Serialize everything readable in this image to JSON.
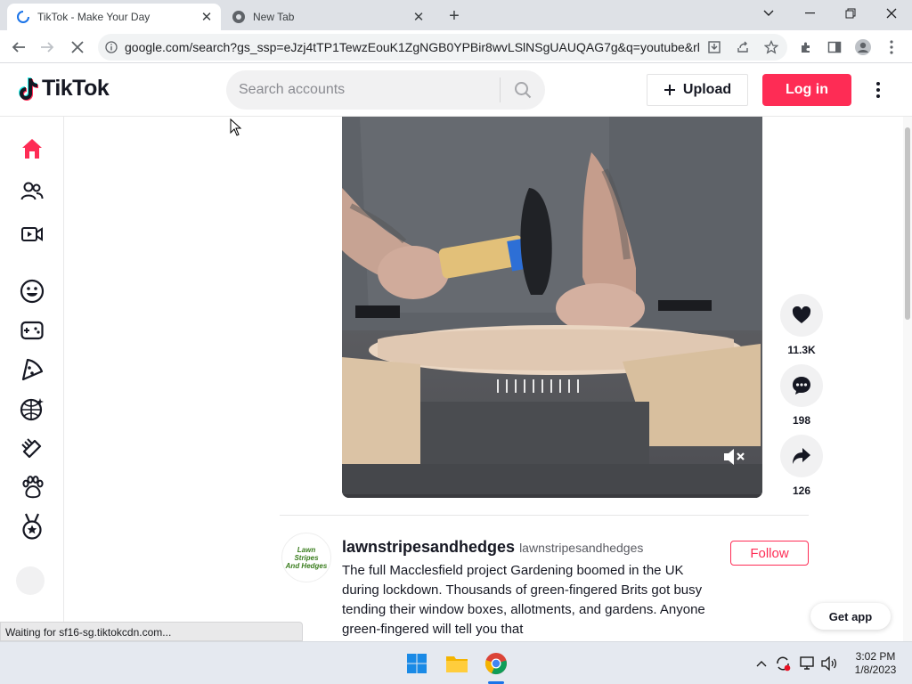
{
  "browser": {
    "tabs": [
      {
        "title": "TikTok - Make Your Day",
        "active": true
      },
      {
        "title": "New Tab",
        "active": false
      }
    ],
    "url": "google.com/search?gs_ssp=eJzj4tTP1TewzEouK1ZgNGB0YPBir8wvLSlNSgUAUQAG7g&q=youtube&rlz...",
    "status_text": "Waiting for sf16-sg.tiktokcdn.com..."
  },
  "tiktok": {
    "logo_text": "TikTok",
    "search_placeholder": "Search accounts",
    "upload_label": "Upload",
    "login_label": "Log in",
    "accent_color": "#fe2c55",
    "sidebar_items": [
      {
        "name": "home",
        "icon": "home-icon",
        "active": true
      },
      {
        "name": "following",
        "icon": "people-icon"
      },
      {
        "name": "live",
        "icon": "live-camera-icon"
      },
      {
        "name": "comedy",
        "icon": "smiley-icon"
      },
      {
        "name": "gaming",
        "icon": "gamepad-icon"
      },
      {
        "name": "food",
        "icon": "pizza-icon"
      },
      {
        "name": "dance",
        "icon": "disco-ball-icon"
      },
      {
        "name": "beauty",
        "icon": "comb-icon"
      },
      {
        "name": "animals",
        "icon": "paw-icon"
      },
      {
        "name": "sports",
        "icon": "medal-icon"
      }
    ],
    "video": {
      "likes": "11.3K",
      "comments": "198",
      "shares": "126"
    },
    "post": {
      "username": "lawnstripesandhedges",
      "nickname": "lawnstripesandhedges",
      "avatar_text": [
        "Lawn",
        "Stripes",
        "And Hedges"
      ],
      "follow_label": "Follow",
      "description": "The full Macclesfield project Gardening boomed in the UK during lockdown. Thousands of green-fingered Brits got busy tending their window boxes, allotments, and gardens. Anyone green-fingered will tell you that"
    },
    "get_app_label": "Get app"
  },
  "taskbar": {
    "time": "3:02 PM",
    "date": "1/8/2023"
  }
}
